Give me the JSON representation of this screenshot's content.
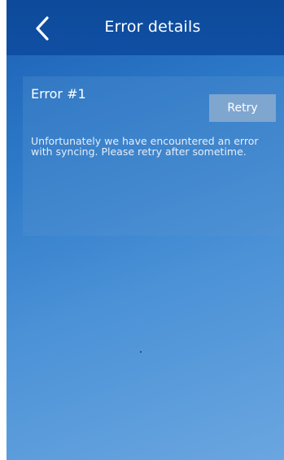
{
  "header": {
    "title": "Error details",
    "back_icon": "chevron-left-icon"
  },
  "error_card": {
    "title": "Error #1",
    "retry_label": "Retry",
    "message": "Unfortunately we have encountered an error with syncing. Please retry after sometime."
  },
  "colors": {
    "header_bg": "#0f4fa3",
    "background_top": "#1a5fb4",
    "background_bottom": "#6aa6e0",
    "retry_button_bg": "#7fa6cf",
    "text": "#ffffff"
  }
}
